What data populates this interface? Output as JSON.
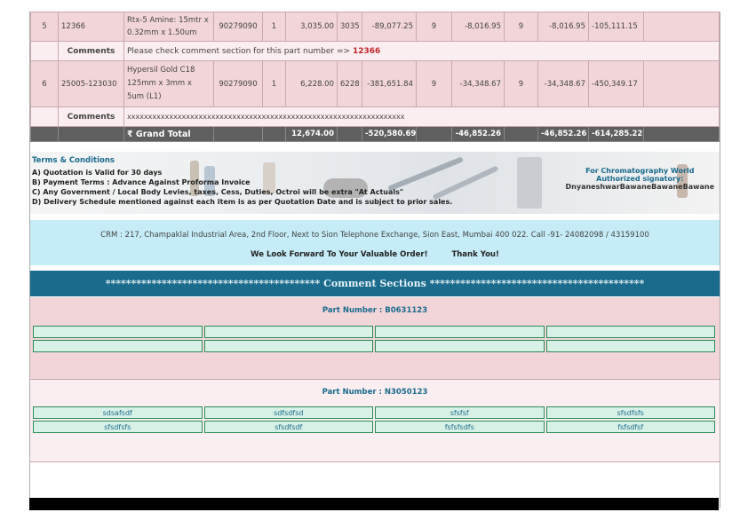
{
  "items": [
    {
      "sr": "5",
      "part_no": "12366",
      "description": "Rtx-5 Amine: 15mtr x 0.32mm x 1.50um",
      "hsn": "90279090",
      "qty": "1",
      "price": "3,035.00",
      "c1": "3035",
      "c2": "-89,077.25",
      "c3": "9",
      "c4": "-8,016.95",
      "c5": "9",
      "c6": "-8,016.95",
      "c7": "-105,111.15",
      "comment_label": "Comments",
      "comment_prefix": "Please check comment section for this part number => ",
      "comment_ref": "12366"
    },
    {
      "sr": "6",
      "part_no": "25005-123030",
      "description": "Hypersil Gold C18 125mm x 3mm x 5um (L1)",
      "hsn": "90279090",
      "qty": "1",
      "price": "6,228.00",
      "c1": "6228",
      "c2": "-381,651.84",
      "c3": "9",
      "c4": "-34,348.67",
      "c5": "9",
      "c6": "-34,348.67",
      "c7": "-450,349.17",
      "comment_label": "Comments",
      "comment_text": "xxxxxxxxxxxxxxxxxxxxxxxxxxxxxxxxxxxxxxxxxxxxxxxxxxxxxxxxxxxxxxxxxx"
    }
  ],
  "grand_total": {
    "label": "₹ Grand Total",
    "price": "12,674.00",
    "c2": "-520,580.69",
    "c4": "-46,852.26",
    "c6": "-46,852.26",
    "c7": "-614,285.22"
  },
  "terms": {
    "title": "Terms & Conditions",
    "lines": [
      "A) Quotation is Valid for 30 days",
      "B) Payment Terms : Advance Against Proforma Invoice",
      "C) Any Government / Local Body Levies, taxes, Cess, Duties, Octroi will be extra \"At Actuals\"",
      "D) Delivery Schedule mentioned against each item is as per Quotation Date and is subject to prior sales."
    ],
    "signatory_company": "For Chromatography World",
    "signatory_title": "Authorized signatory:",
    "signatory_name": "DnyaneshwarBawaneBawaneBawane"
  },
  "footer": {
    "address": "CRM : 217, Champaklal Industrial Area, 2nd Floor, Next to Sion Telephone Exchange, Sion East, Mumbai 400 022. Call -91- 24082098 / 43159100",
    "thanks_1": "We Look Forward To Your Valuable Order!",
    "thanks_2": "Thank You!"
  },
  "comment_sections": {
    "header": "****************************************** Comment Sections ******************************************",
    "parts": [
      {
        "title": "Part Number : B0631123",
        "rows": [
          [
            "",
            "",
            "",
            ""
          ],
          [
            "",
            "",
            "",
            ""
          ]
        ]
      },
      {
        "title": "Part Number : N3050123",
        "rows": [
          [
            "sdsafsdf",
            "sdfsdfsd",
            "sfsfsf",
            "sfsdfsfs"
          ],
          [
            "sfsdfsfs",
            "sfsdfsdf",
            "fsfsfsdfs",
            "fsfsdfsf"
          ]
        ]
      }
    ]
  },
  "colors": {
    "accent": "#1a6b8c",
    "row_pink": "#f2d5d9",
    "total_gray": "#5f5f5f",
    "crm_blue": "#c5ecf7",
    "grid_green": "#2e8b57"
  }
}
